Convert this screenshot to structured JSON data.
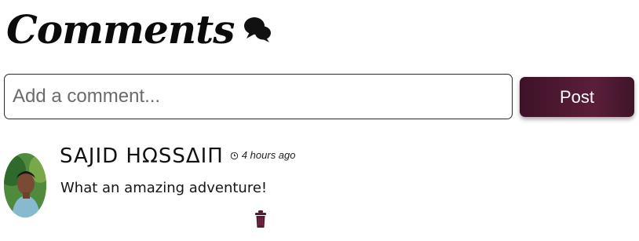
{
  "header": {
    "title": "Comments",
    "icon": "comments-icon"
  },
  "form": {
    "placeholder": "Add a comment...",
    "value": "",
    "post_label": "Post",
    "post_color": "#4a1730"
  },
  "comments": [
    {
      "author": "SAJID HΩSSΔIΠ",
      "time": "4 hours ago",
      "text": "What an amazing adventure!",
      "avatar": "avatar",
      "delete_icon": "trash-icon",
      "delete_color": "#5a1a34"
    }
  ]
}
